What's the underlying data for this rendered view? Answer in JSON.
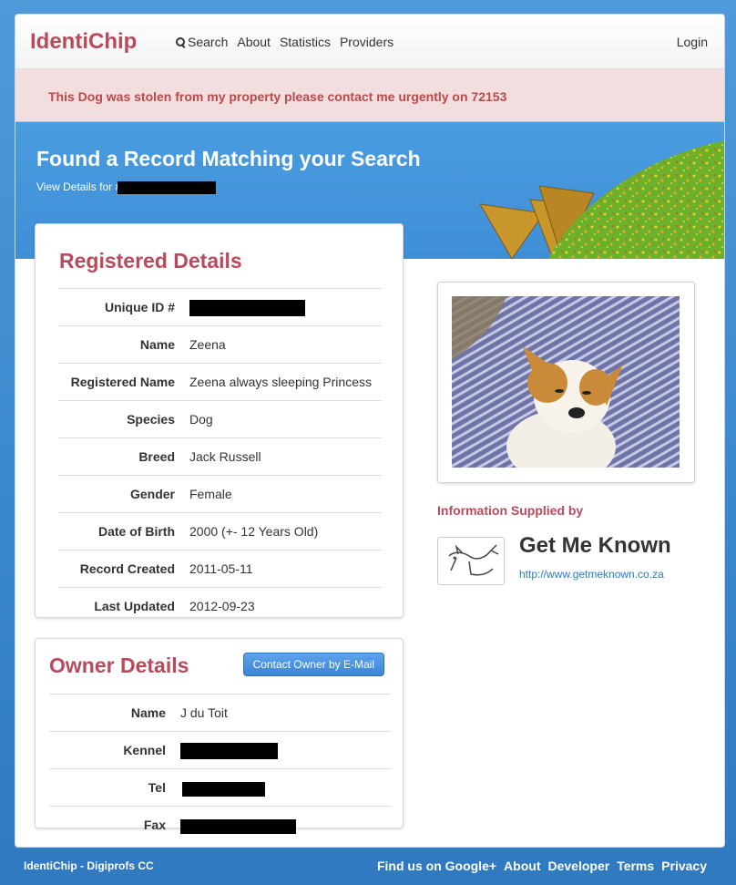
{
  "nav": {
    "brand": "IdentiChip",
    "links": [
      {
        "label": "Search",
        "icon": "search-icon"
      },
      {
        "label": "About"
      },
      {
        "label": "Statistics"
      },
      {
        "label": "Providers"
      }
    ],
    "login": "Login"
  },
  "alert": {
    "message": "This Dog was stolen from my property please contact me urgently on 72153"
  },
  "hero": {
    "title": "Found a Record Matching your Search",
    "subtitle_prefix": "View Details for #"
  },
  "registered": {
    "heading": "Registered Details",
    "rows": [
      {
        "key": "Unique ID #",
        "value": ""
      },
      {
        "key": "Name",
        "value": "Zeena"
      },
      {
        "key": "Registered Name",
        "value": "Zeena always sleeping Princess"
      },
      {
        "key": "Species",
        "value": "Dog"
      },
      {
        "key": "Breed",
        "value": "Jack Russell"
      },
      {
        "key": "Gender",
        "value": "Female"
      },
      {
        "key": "Date of Birth",
        "value": "2000 (+- 12 Years Old)"
      },
      {
        "key": "Record Created",
        "value": "2011-05-11"
      },
      {
        "key": "Last Updated",
        "value": "2012-09-23"
      }
    ]
  },
  "owner": {
    "heading": "Owner Details",
    "contact_button": "Contact Owner by E-Mail",
    "rows": [
      {
        "key": "Name",
        "value": "J du Toit"
      },
      {
        "key": "Kennel",
        "value": ""
      },
      {
        "key": "Tel",
        "value": ""
      },
      {
        "key": "Fax",
        "value": ""
      }
    ]
  },
  "provider": {
    "title": "Information Supplied by",
    "name": "Get Me Known",
    "url": "http://www.getmeknown.co.za"
  },
  "footer": {
    "left": "IdentiChip - Digiprofs CC",
    "links": [
      "Find us on Google+",
      "About",
      "Developer",
      "Terms",
      "Privacy"
    ]
  }
}
